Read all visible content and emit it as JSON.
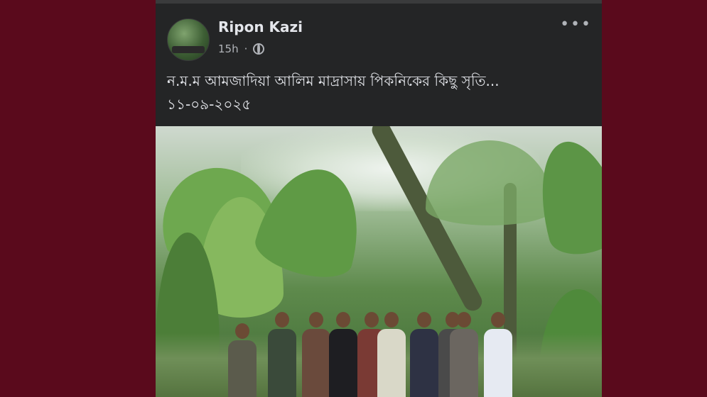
{
  "post": {
    "author_name": "Ripon Kazi",
    "time": "15h",
    "separator": "·",
    "privacy_icon": "globe-icon",
    "more_icon": "more-options-icon",
    "more_label": "•••",
    "text_line1": "ন.ম.ম আমজাদিয়া আলিম মাদ্রাসায় পিকনিকের কিছু সৃতি...",
    "text_line2": "১১-০৯-২০২৫"
  },
  "colors": {
    "page_bg": "#5a0a1c",
    "card_bg": "#242526",
    "text_primary": "#e4e6eb",
    "text_secondary": "#b0b3b8"
  }
}
